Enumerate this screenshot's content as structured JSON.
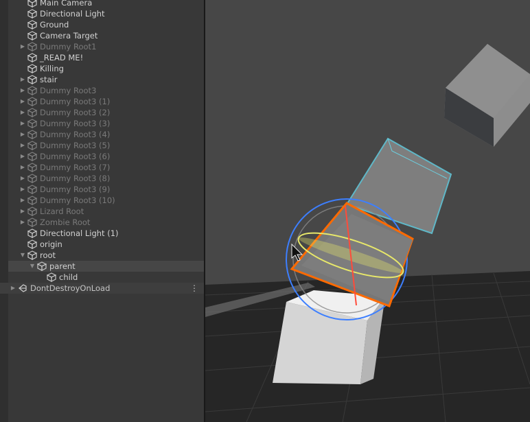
{
  "hierarchy": {
    "items": [
      {
        "label": "Main Camera",
        "active": true,
        "foldout": "none",
        "depth": 0
      },
      {
        "label": "Directional Light",
        "active": true,
        "foldout": "none",
        "depth": 0
      },
      {
        "label": "Ground",
        "active": true,
        "foldout": "none",
        "depth": 0
      },
      {
        "label": "Camera Target",
        "active": true,
        "foldout": "none",
        "depth": 0
      },
      {
        "label": "Dummy Root1",
        "active": false,
        "foldout": "collapsed",
        "depth": 0
      },
      {
        "label": "_READ ME!",
        "active": true,
        "foldout": "none",
        "depth": 0
      },
      {
        "label": "Killing",
        "active": true,
        "foldout": "none",
        "depth": 0
      },
      {
        "label": "stair",
        "active": true,
        "foldout": "collapsed",
        "depth": 0
      },
      {
        "label": "Dummy Root3",
        "active": false,
        "foldout": "collapsed",
        "depth": 0
      },
      {
        "label": "Dummy Root3 (1)",
        "active": false,
        "foldout": "collapsed",
        "depth": 0
      },
      {
        "label": "Dummy Root3 (2)",
        "active": false,
        "foldout": "collapsed",
        "depth": 0
      },
      {
        "label": "Dummy Root3 (3)",
        "active": false,
        "foldout": "collapsed",
        "depth": 0
      },
      {
        "label": "Dummy Root3 (4)",
        "active": false,
        "foldout": "collapsed",
        "depth": 0
      },
      {
        "label": "Dummy Root3 (5)",
        "active": false,
        "foldout": "collapsed",
        "depth": 0
      },
      {
        "label": "Dummy Root3 (6)",
        "active": false,
        "foldout": "collapsed",
        "depth": 0
      },
      {
        "label": "Dummy Root3 (7)",
        "active": false,
        "foldout": "collapsed",
        "depth": 0
      },
      {
        "label": "Dummy Root3 (8)",
        "active": false,
        "foldout": "collapsed",
        "depth": 0
      },
      {
        "label": "Dummy Root3 (9)",
        "active": false,
        "foldout": "collapsed",
        "depth": 0
      },
      {
        "label": "Dummy Root3 (10)",
        "active": false,
        "foldout": "collapsed",
        "depth": 0
      },
      {
        "label": "Lizard Root",
        "active": false,
        "foldout": "collapsed",
        "depth": 0
      },
      {
        "label": "Zombie Root",
        "active": false,
        "foldout": "collapsed",
        "depth": 0
      },
      {
        "label": "Directional Light (1)",
        "active": true,
        "foldout": "none",
        "depth": 0
      },
      {
        "label": "origin",
        "active": true,
        "foldout": "none",
        "depth": 0
      },
      {
        "label": "root",
        "active": true,
        "foldout": "expanded",
        "depth": 0
      },
      {
        "label": "parent",
        "active": true,
        "foldout": "expanded",
        "depth": 1,
        "selected": true
      },
      {
        "label": "child",
        "active": true,
        "foldout": "none",
        "depth": 2
      }
    ],
    "scene_header": {
      "label": "DontDestroyOnLoad",
      "menu_glyph": "⋮"
    }
  },
  "icons": {
    "gameobject": "cube-icon",
    "scene": "unity-scene-icon",
    "fold_collapsed": "▶",
    "fold_expanded": "▼"
  },
  "colors": {
    "selection_outline": "#ff6a00",
    "child_outline": "#5fb8c8",
    "rotate_gizmo_z": "#3d7fff",
    "rotate_gizmo_y": "#e8e86a",
    "rotate_gizmo_x": "#ff4b3a"
  }
}
